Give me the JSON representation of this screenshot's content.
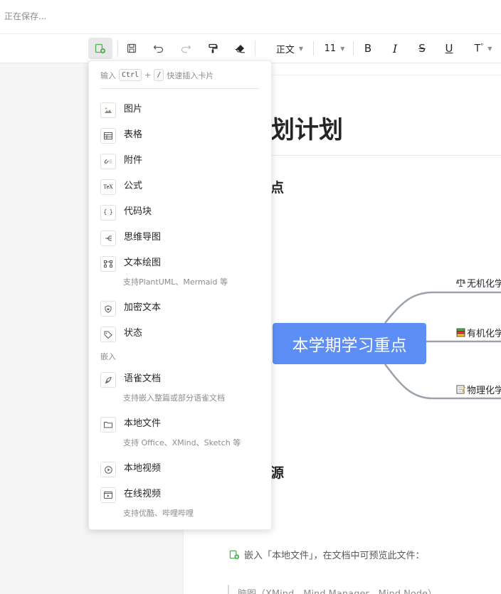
{
  "status": {
    "saving_text": "正在保存..."
  },
  "toolbar": {
    "paragraph_style": "正文",
    "font_size": "11",
    "buttons": [
      "insert",
      "save",
      "undo",
      "redo",
      "format-painter",
      "clear-format",
      "bold",
      "italic",
      "strikethrough",
      "underline",
      "more-format"
    ]
  },
  "insert_menu": {
    "hint_prefix": "输入",
    "hint_key1": "Ctrl",
    "hint_plus": "+",
    "hint_key2": "/",
    "hint_suffix": "快速插入卡片",
    "items": [
      {
        "label": "图片",
        "icon": "image-icon"
      },
      {
        "label": "表格",
        "icon": "table-icon"
      },
      {
        "label": "附件",
        "icon": "attachment-icon"
      },
      {
        "label": "公式",
        "icon": "formula-icon"
      },
      {
        "label": "代码块",
        "icon": "code-block-icon"
      },
      {
        "label": "思维导图",
        "icon": "mindmap-icon"
      },
      {
        "label": "文本绘图",
        "icon": "text-diagram-icon",
        "sub": "支持PlantUML、Mermaid 等"
      },
      {
        "label": "加密文本",
        "icon": "lock-icon"
      },
      {
        "label": "状态",
        "icon": "tag-icon"
      }
    ],
    "embed_section": "嵌入",
    "embed_items": [
      {
        "label": "语雀文档",
        "icon": "yuque-doc-icon",
        "sub": "支持嵌入整篇或部分语雀文档"
      },
      {
        "label": "本地文件",
        "icon": "folder-icon",
        "sub": "支持 Office、XMind、Sketch 等"
      },
      {
        "label": "本地视频",
        "icon": "play-icon"
      },
      {
        "label": "在线视频",
        "icon": "online-video-icon",
        "sub": "支持优酷、哔哩哔哩"
      }
    ]
  },
  "document": {
    "title": "划计划",
    "heading_1": "点",
    "heading_2": "源",
    "mindmap": {
      "center": "本学期学习重点",
      "branches": [
        {
          "label": "无机化学",
          "icon": "scale-emoji"
        },
        {
          "label": "有机化学",
          "icon": "books-emoji"
        },
        {
          "label": "物理化学",
          "icon": "memo-emoji"
        }
      ]
    },
    "embed_line": "嵌入「本地文件」，在文档中可预览此文件：",
    "quote_text": "脑图（XMind、Mind Manager、Mind Node）"
  },
  "colors": {
    "accent": "#5c8ef5",
    "insert_green": "#4caf50",
    "connector": "#9aa3ad"
  }
}
